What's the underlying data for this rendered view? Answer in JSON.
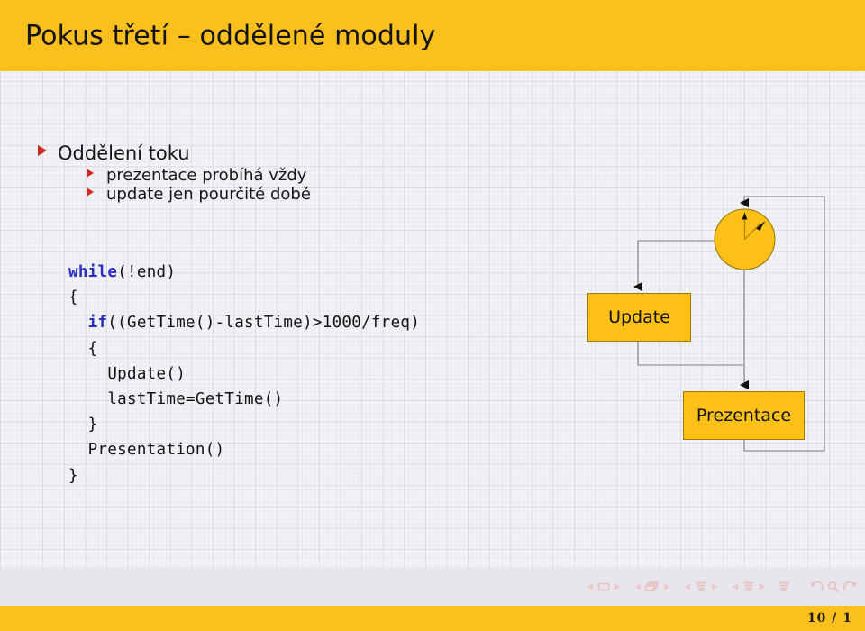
{
  "slide": {
    "title": "Pokus třetí – oddělené moduly",
    "title_bar_color": "#fbc01e",
    "background_color": "#f3f3f7",
    "accent_color": "#fcc016",
    "bullet_color": "#cf2a1e",
    "keyword_color": "#2a2fc4"
  },
  "bullets": {
    "level1": {
      "icon": "triangle-right-icon",
      "label": "Oddělení toku"
    },
    "level2": [
      {
        "icon": "triangle-right-icon",
        "label": "prezentace probíhá vždy"
      },
      {
        "icon": "triangle-right-icon",
        "label": "update jen pourčité době"
      }
    ]
  },
  "code": {
    "language": "cpp",
    "lines": [
      {
        "indent": 0,
        "keyword": "while",
        "rest": "(!end)"
      },
      {
        "indent": 0,
        "keyword": "",
        "rest": "{"
      },
      {
        "indent": 1,
        "keyword": "if",
        "rest": "((GetTime()-lastTime)>1000/freq)"
      },
      {
        "indent": 1,
        "keyword": "",
        "rest": "{"
      },
      {
        "indent": 2,
        "keyword": "",
        "rest": "Update()"
      },
      {
        "indent": 2,
        "keyword": "",
        "rest": "lastTime=GetTime()"
      },
      {
        "indent": 1,
        "keyword": "",
        "rest": "}"
      },
      {
        "indent": 1,
        "keyword": "",
        "rest": "Presentation()"
      },
      {
        "indent": 0,
        "keyword": "",
        "rest": "}"
      }
    ]
  },
  "diagram": {
    "clock": {
      "name": "clock-timer-icon",
      "label": ""
    },
    "boxes": [
      {
        "id": "update",
        "label": "Update"
      },
      {
        "id": "present",
        "label": "Prezentace"
      }
    ],
    "edge_color": "#7a7a85",
    "arrow_color": "#111111"
  },
  "footer": {
    "page_number": "10 / 1",
    "nav": [
      {
        "name": "nav-slide-group",
        "symbol": "frame-icon"
      },
      {
        "name": "nav-frame-group",
        "symbol": "frames-icon"
      },
      {
        "name": "nav-subsection-group",
        "symbol": "subsection-icon"
      },
      {
        "name": "nav-section-group",
        "symbol": "section-icon"
      },
      {
        "name": "nav-doc",
        "symbol": "document-icon"
      },
      {
        "name": "nav-back",
        "symbol": "back-icon"
      },
      {
        "name": "nav-search",
        "symbol": "search-icon"
      },
      {
        "name": "nav-forward",
        "symbol": "forward-icon"
      }
    ]
  }
}
